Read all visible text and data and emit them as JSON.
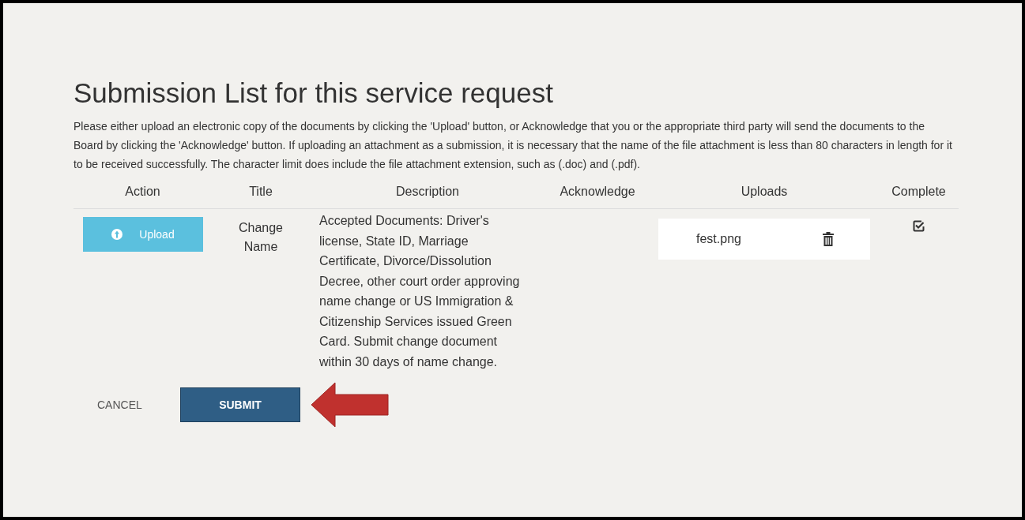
{
  "heading": "Submission List for this service request",
  "instructions": "Please either upload an electronic copy of the documents by clicking the 'Upload' button, or Acknowledge that you or the appropriate third party will send the documents to the Board by clicking the 'Acknowledge' button. If uploading an attachment as a submission, it is necessary that the name of the file attachment is less than 80 characters in length for it to be received successfully. The character limit does include the file attachment extension, such as (.doc) and (.pdf).",
  "table": {
    "columns": [
      "Action",
      "Title",
      "Description",
      "Acknowledge",
      "Uploads",
      "Complete"
    ],
    "rows": [
      {
        "action": "Upload",
        "title": "Change Name",
        "description": "Accepted Documents: Driver's license, State ID, Marriage Certificate, Divorce/Dissolution Decree, other court order approving name change or US Immigration & Citizenship Services issued Green Card. Submit change document within 30 days of name change.",
        "uploads": [
          "fest.png"
        ],
        "complete": true
      }
    ]
  },
  "buttons": {
    "cancel": "CANCEL",
    "submit": "SUBMIT"
  }
}
